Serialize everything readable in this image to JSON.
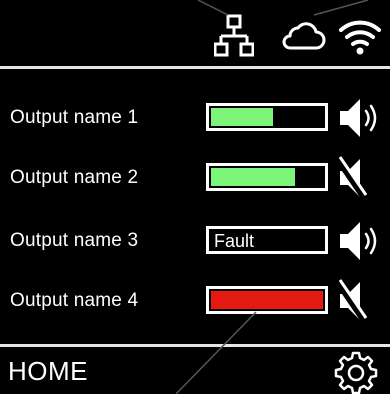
{
  "header": {
    "icons": [
      "network-icon",
      "cloud-icon",
      "wifi-icon"
    ]
  },
  "outputs": [
    {
      "label": "Output name 1",
      "level": 0.55,
      "fill_color": "#7cf57a",
      "status_text": "",
      "muted": false
    },
    {
      "label": "Output name 2",
      "level": 0.75,
      "fill_color": "#7cf57a",
      "status_text": "",
      "muted": true
    },
    {
      "label": "Output name 3",
      "level": 0,
      "fill_color": "#7cf57a",
      "status_text": "Fault",
      "muted": false
    },
    {
      "label": "Output name 4",
      "level": 1.0,
      "fill_color": "#e41a12",
      "status_text": "",
      "muted": true
    }
  ],
  "footer": {
    "home_label": "HOME",
    "settings_icon": "gear-icon"
  },
  "colors": {
    "background": "#000000",
    "foreground": "#ffffff",
    "level_ok": "#7cf57a",
    "level_alarm": "#e41a12",
    "divider": "#e6e6e6"
  }
}
